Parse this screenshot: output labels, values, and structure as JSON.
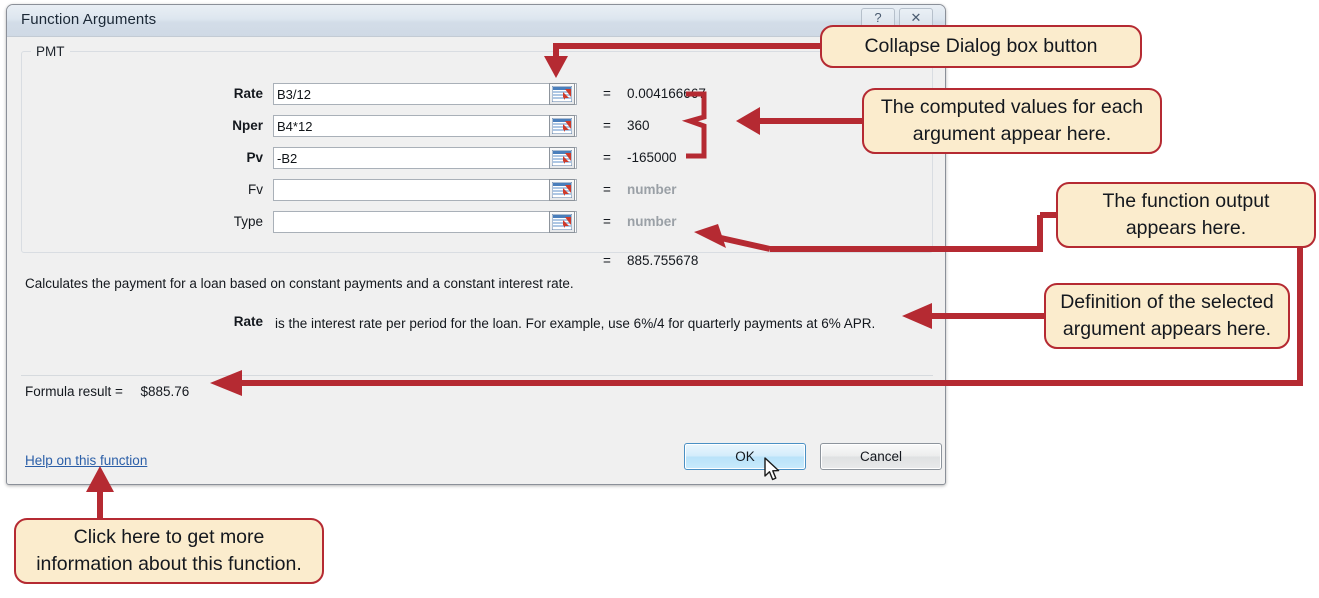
{
  "dialog": {
    "title": "Function Arguments",
    "title_buttons": [
      {
        "name": "help-button",
        "glyph": "?"
      },
      {
        "name": "close-button",
        "glyph": "✕"
      }
    ],
    "group_label": "PMT",
    "equals_sign": "=",
    "arguments": [
      {
        "label": "Rate",
        "required": true,
        "value": "B3/12",
        "result": "0.004166667",
        "placeholder": false
      },
      {
        "label": "Nper",
        "required": true,
        "value": "B4*12",
        "result": "360",
        "placeholder": false
      },
      {
        "label": "Pv",
        "required": true,
        "value": "-B2",
        "result": "-165000",
        "placeholder": false
      },
      {
        "label": "Fv",
        "required": false,
        "value": "",
        "result": "number",
        "placeholder": true
      },
      {
        "label": "Type",
        "required": false,
        "value": "",
        "result": "number",
        "placeholder": true
      }
    ],
    "overall_result": "885.755678",
    "function_description": "Calculates the payment for a loan based on constant payments and a constant interest rate.",
    "selected_argument_name": "Rate",
    "selected_argument_help": "is the interest rate per period for the loan. For example, use 6%/4 for quarterly payments at 6% APR.",
    "formula_result_label": "Formula result =",
    "formula_result_value": "$885.76",
    "help_link": "Help on this function",
    "ok_label": "OK",
    "cancel_label": "Cancel",
    "collapse_icon_name": "collapse-dialog-icon"
  },
  "callouts": [
    {
      "name": "callout-collapse-dialog",
      "text": "Collapse Dialog box button"
    },
    {
      "name": "callout-computed-values",
      "text": "The computed values for each argument appear here."
    },
    {
      "name": "callout-function-output",
      "text": "The function output appears here."
    },
    {
      "name": "callout-argument-definition",
      "text": "Definition of the selected argument appears here."
    },
    {
      "name": "callout-help-link",
      "text": "Click here to get more information about this function."
    }
  ],
  "colors": {
    "callout_fill": "#FBECCD",
    "callout_border": "#B52A32",
    "annotation_red": "#B52A32",
    "dialog_body": "#F0F0F0",
    "titlebar": "#D8E2EC",
    "link_blue": "#2B5FA8",
    "ok_button_blue": "#C9EBFC",
    "placeholder_gray": "#9AA0A6"
  }
}
